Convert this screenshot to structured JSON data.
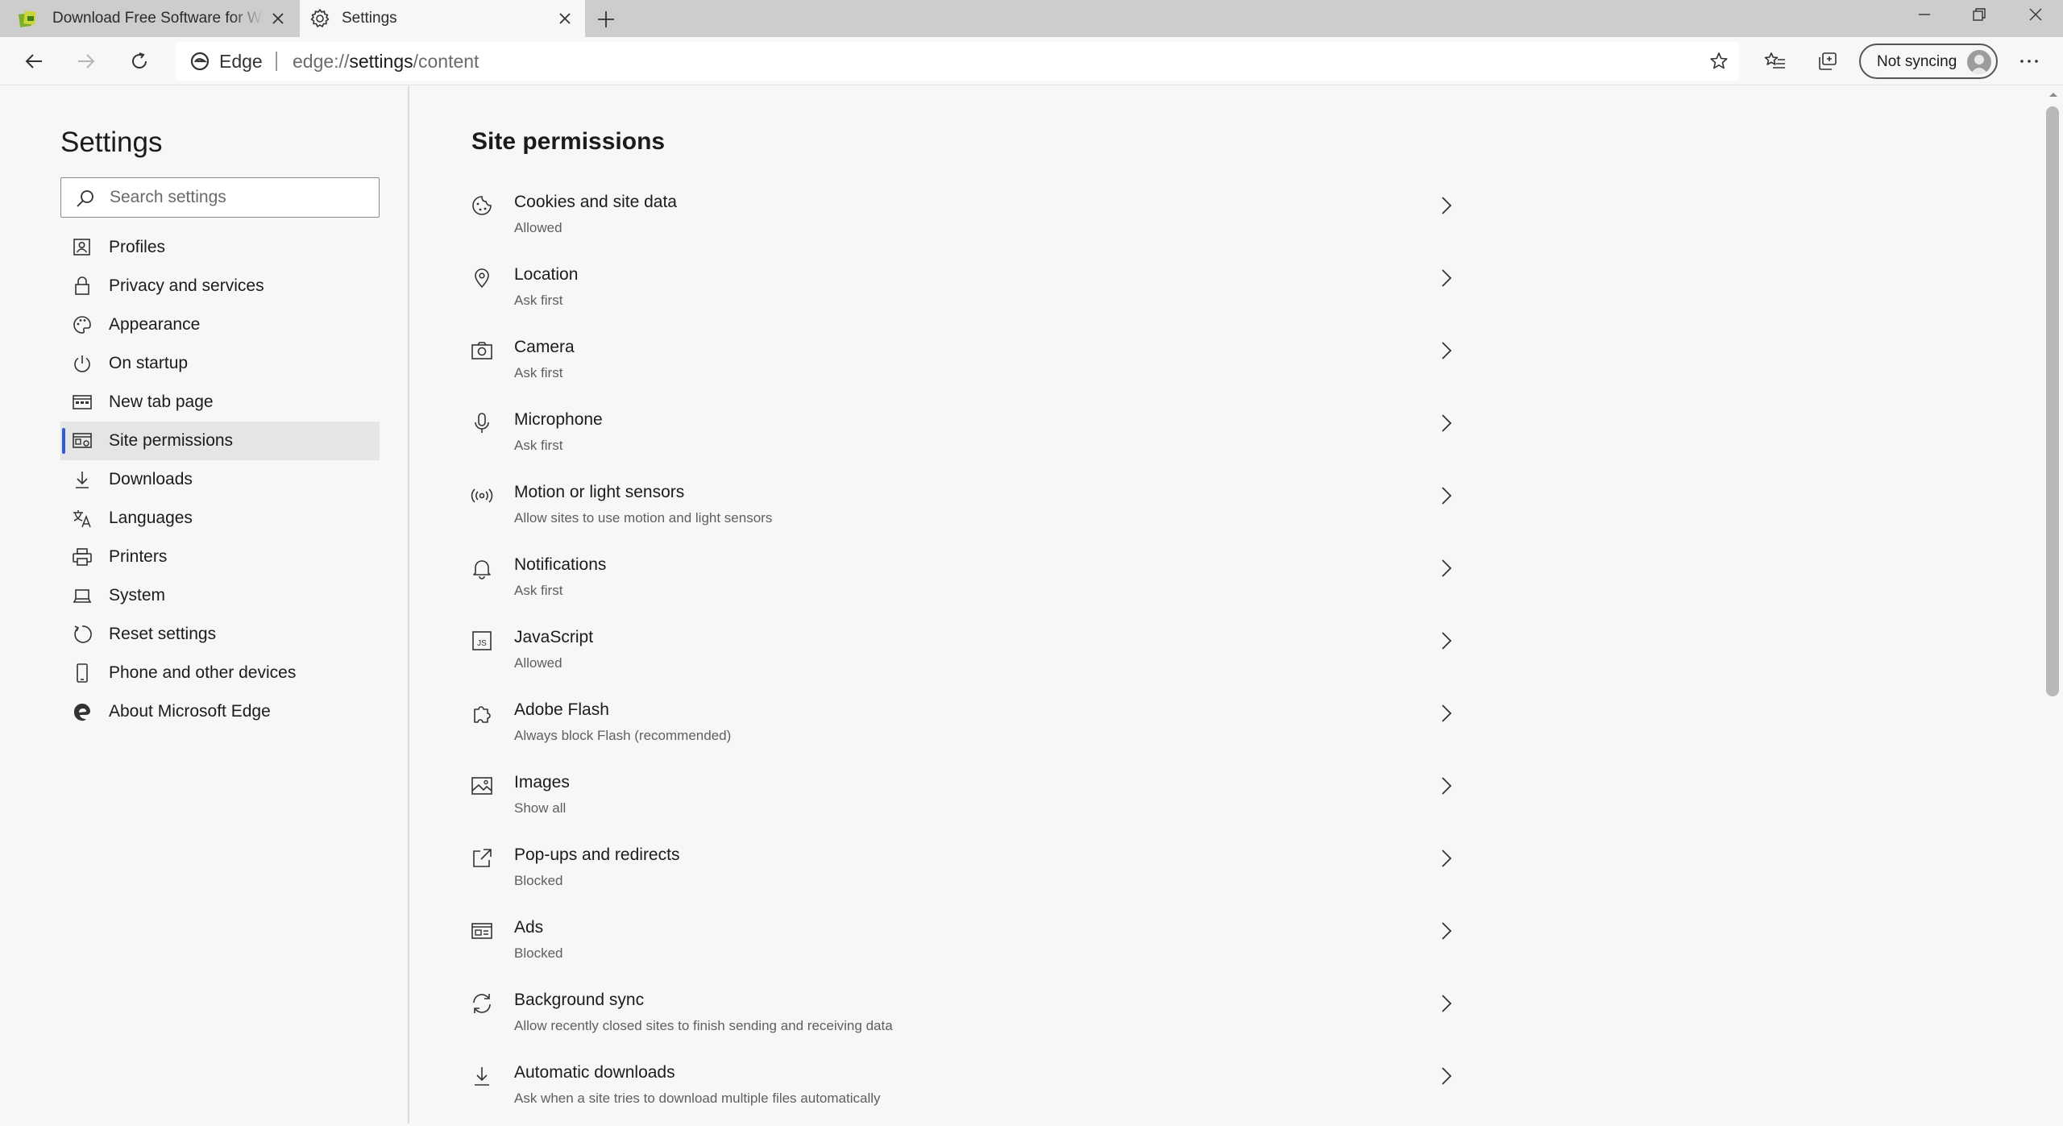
{
  "browser": {
    "tabs": [
      {
        "title": "Download Free Software for Windows",
        "favicon": "software-site-icon"
      },
      {
        "title": "Settings",
        "favicon": "gear-icon"
      }
    ],
    "omnibox": {
      "brand": "Edge",
      "url_scheme": "edge://",
      "url_host": "settings",
      "url_path": "/content"
    },
    "profile": {
      "label": "Not syncing"
    }
  },
  "sidebar": {
    "title": "Settings",
    "search_placeholder": "Search settings",
    "items": [
      {
        "label": "Profiles",
        "icon": "profile-icon"
      },
      {
        "label": "Privacy and services",
        "icon": "lock-icon"
      },
      {
        "label": "Appearance",
        "icon": "palette-icon"
      },
      {
        "label": "On startup",
        "icon": "power-icon"
      },
      {
        "label": "New tab page",
        "icon": "new-tab-page-icon"
      },
      {
        "label": "Site permissions",
        "icon": "site-permissions-icon",
        "active": true
      },
      {
        "label": "Downloads",
        "icon": "download-icon"
      },
      {
        "label": "Languages",
        "icon": "languages-icon"
      },
      {
        "label": "Printers",
        "icon": "printer-icon"
      },
      {
        "label": "System",
        "icon": "system-icon"
      },
      {
        "label": "Reset settings",
        "icon": "reset-icon"
      },
      {
        "label": "Phone and other devices",
        "icon": "phone-icon"
      },
      {
        "label": "About Microsoft Edge",
        "icon": "edge-logo-icon"
      }
    ]
  },
  "main": {
    "title": "Site permissions",
    "permissions": [
      {
        "title": "Cookies and site data",
        "subtitle": "Allowed",
        "icon": "cookie-icon"
      },
      {
        "title": "Location",
        "subtitle": "Ask first",
        "icon": "location-pin-icon"
      },
      {
        "title": "Camera",
        "subtitle": "Ask first",
        "icon": "camera-icon"
      },
      {
        "title": "Microphone",
        "subtitle": "Ask first",
        "icon": "microphone-icon"
      },
      {
        "title": "Motion or light sensors",
        "subtitle": "Allow sites to use motion and light sensors",
        "icon": "sensor-icon"
      },
      {
        "title": "Notifications",
        "subtitle": "Ask first",
        "icon": "bell-icon"
      },
      {
        "title": "JavaScript",
        "subtitle": "Allowed",
        "icon": "javascript-icon"
      },
      {
        "title": "Adobe Flash",
        "subtitle": "Always block Flash (recommended)",
        "icon": "puzzle-icon"
      },
      {
        "title": "Images",
        "subtitle": "Show all",
        "icon": "image-icon"
      },
      {
        "title": "Pop-ups and redirects",
        "subtitle": "Blocked",
        "icon": "popup-icon"
      },
      {
        "title": "Ads",
        "subtitle": "Blocked",
        "icon": "ads-icon"
      },
      {
        "title": "Background sync",
        "subtitle": "Allow recently closed sites to finish sending and receiving data",
        "icon": "sync-icon"
      },
      {
        "title": "Automatic downloads",
        "subtitle": "Ask when a site tries to download multiple files automatically",
        "icon": "download-icon"
      }
    ]
  },
  "colors": {
    "accent": "#2c5dd6",
    "active_nav_bg": "#e5e5e5",
    "page_bg": "#f7f7f7",
    "tabstrip_bg": "#cdcdcd"
  }
}
